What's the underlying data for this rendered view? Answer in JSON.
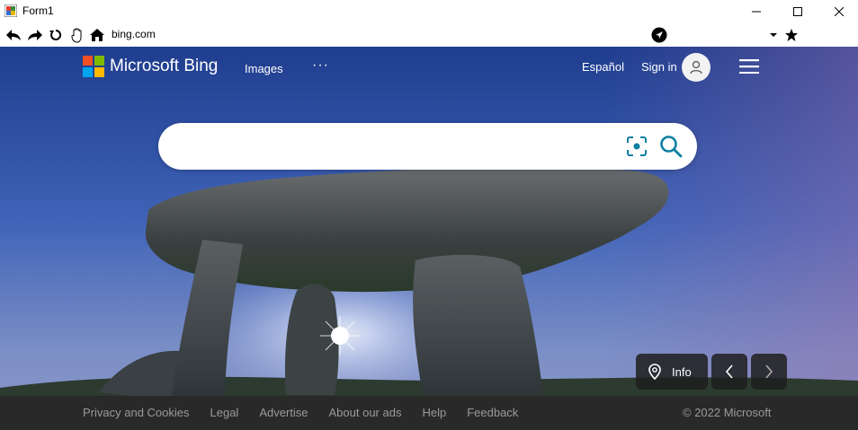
{
  "window": {
    "title": "Form1",
    "icon": "winforms-app-icon"
  },
  "toolbar": {
    "address": "bing.com",
    "buttons": [
      "back-icon",
      "forward-icon",
      "refresh-icon",
      "hand-icon",
      "home-icon"
    ]
  },
  "header": {
    "brand": "Microsoft Bing",
    "nav_images": "Images",
    "nav_more": "···",
    "language": "Español",
    "sign_in": "Sign in"
  },
  "search": {
    "value": "",
    "placeholder": ""
  },
  "image_controls": {
    "info_label": "Info"
  },
  "footer": {
    "links": [
      "Privacy and Cookies",
      "Legal",
      "Advertise",
      "About our ads",
      "Help",
      "Feedback"
    ],
    "copyright": "© 2022 Microsoft"
  },
  "colors": {
    "logo_red": "#f25022",
    "logo_green": "#7fba00",
    "logo_blue": "#00a4ef",
    "logo_yellow": "#ffb900",
    "search_icon": "#0f7fa3",
    "footer_bg": "#282828",
    "footer_text": "#9a9a9a"
  }
}
